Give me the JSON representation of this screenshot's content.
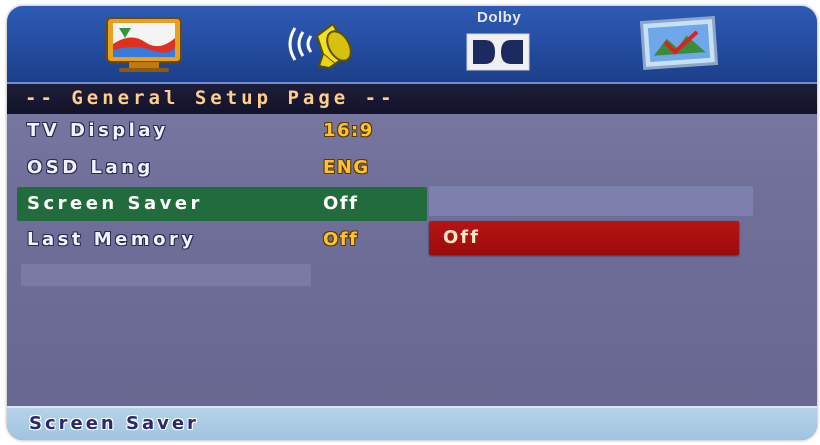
{
  "icons": [
    {
      "id": "general",
      "name": "tv-monitor-icon"
    },
    {
      "id": "audio",
      "name": "speaker-icon"
    },
    {
      "id": "dolby",
      "name": "dolby-icon",
      "label": "Dolby"
    },
    {
      "id": "preference",
      "name": "preference-picture-icon"
    }
  ],
  "header": {
    "title": "-- General Setup Page --"
  },
  "settings": [
    {
      "label": "TV Display",
      "value": "16:9"
    },
    {
      "label": "OSD Lang",
      "value": "ENG"
    },
    {
      "label": "Screen Saver",
      "value": "Off",
      "selected": true
    },
    {
      "label": "Last Memory",
      "value": "Off"
    }
  ],
  "submenu": {
    "options": [
      "Off"
    ]
  },
  "status": {
    "text": "Screen Saver"
  },
  "colors": {
    "icon_bar": "#2f5bb5",
    "title_bg": "#1a1a35",
    "title_text": "#ffcf8a",
    "menu_bg": "#7a7aa3",
    "value_text": "#ffc22e",
    "selected_row": "#226b3c",
    "submenu_option": "#b81414",
    "status_bar": "#aacbe5"
  }
}
